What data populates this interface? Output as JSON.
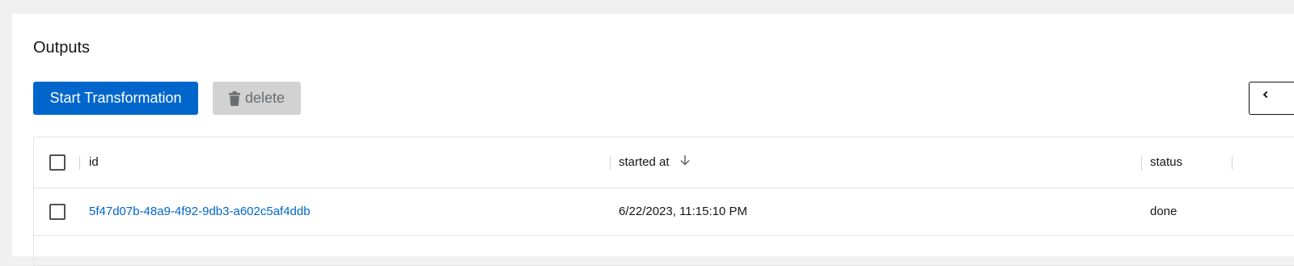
{
  "section": {
    "title": "Outputs"
  },
  "toolbar": {
    "start_label": "Start Transformation",
    "delete_label": "delete",
    "delete_icon": "trash-icon",
    "edge_icon": "chevron-left-icon"
  },
  "table": {
    "columns": [
      {
        "label": "id"
      },
      {
        "label": "started at",
        "sort": "descending",
        "sort_icon": "arrow-down-icon"
      },
      {
        "label": "status"
      }
    ],
    "rows": [
      {
        "id": "5f47d07b-48a9-4f92-9db3-a602c5af4ddb",
        "started_at": "6/22/2023, 11:15:10 PM",
        "status": "done"
      }
    ]
  },
  "colors": {
    "primary": "#0066cc",
    "disabled_bg": "#d2d2d2",
    "disabled_text": "#6a6e73",
    "link": "#0066cc",
    "page_bg": "#f0f0f0"
  }
}
